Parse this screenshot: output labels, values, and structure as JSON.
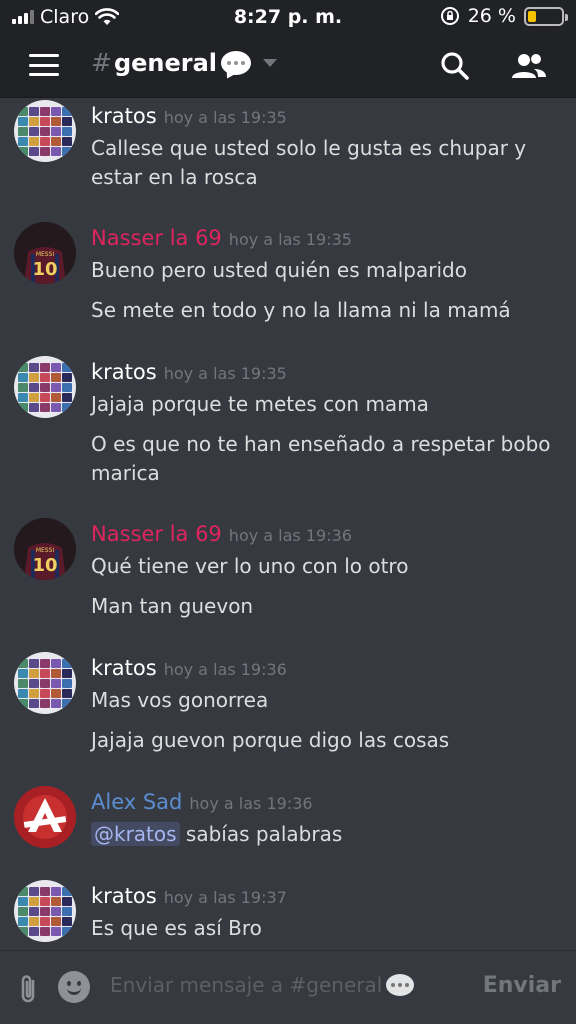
{
  "status_bar": {
    "carrier": "Claro",
    "time": "8:27 p. m.",
    "battery_percent": "26 %",
    "battery_level": 0.26
  },
  "header": {
    "channel_name": "general",
    "menu_icon": "hamburger-menu-icon",
    "search_icon": "search-icon",
    "members_icon": "members-icon"
  },
  "colors": {
    "kratos": "#ffffff",
    "nasser": "#e0245e",
    "alex": "#5b8ed1",
    "background": "#36393f",
    "header": "#202225"
  },
  "messages": [
    {
      "author": "kratos",
      "timestamp": "hoy a las 19:35",
      "lines": [
        "Callese que usted solo le gusta es chupar y estar en la rosca"
      ]
    },
    {
      "author": "Nasser la 69",
      "timestamp": "hoy a las 19:35",
      "lines": [
        "Bueno pero usted quién es malparido",
        "Se mete en todo y no la llama ni la mamá"
      ]
    },
    {
      "author": "kratos",
      "timestamp": "hoy a las 19:35",
      "lines": [
        "Jajaja porque te metes con mama",
        "O es que no te han enseñado a respetar bobo marica"
      ]
    },
    {
      "author": "Nasser la 69",
      "timestamp": "hoy a las 19:36",
      "lines": [
        "Qué tiene ver lo uno con lo otro",
        "Man tan guevon"
      ]
    },
    {
      "author": "kratos",
      "timestamp": "hoy a las 19:36",
      "lines": [
        "Mas vos gonorrea",
        "Jajaja guevon porque digo las cosas"
      ]
    },
    {
      "author": "Alex Sad",
      "timestamp": "hoy a las 19:36",
      "mention": "@kratos",
      "lines": [
        "sabías palabras"
      ]
    },
    {
      "author": "kratos",
      "timestamp": "hoy a las 19:37",
      "lines": [
        "Es que es así Bro"
      ]
    }
  ],
  "avatars": {
    "messi_jersey_text": "MESSI",
    "messi_number": "10"
  },
  "composer": {
    "placeholder": "Enviar mensaje a #general",
    "send_label": "Enviar",
    "attach_icon": "paperclip-icon",
    "emoji_icon": "emoji-icon"
  }
}
